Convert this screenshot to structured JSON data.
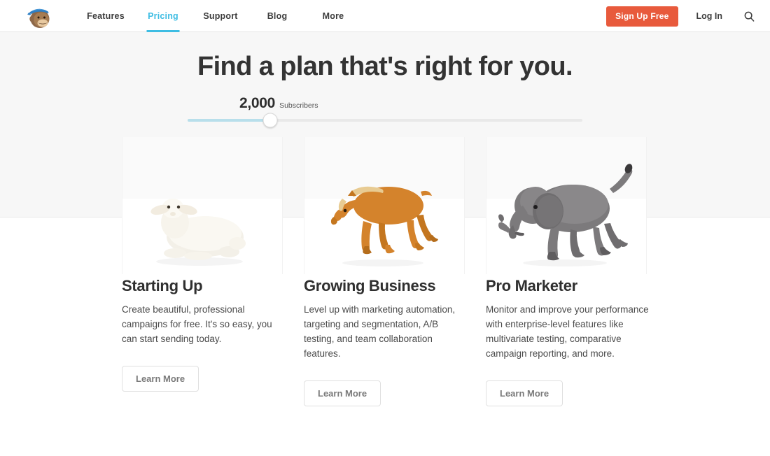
{
  "nav": {
    "logo_icon": "mailchimp-freddie-logo",
    "links": [
      {
        "label": "Features",
        "active": false
      },
      {
        "label": "Pricing",
        "active": true
      },
      {
        "label": "Support",
        "active": false
      },
      {
        "label": "Blog",
        "active": false
      },
      {
        "label": "More",
        "active": false
      }
    ],
    "signup_label": "Sign Up Free",
    "login_label": "Log In",
    "search_icon": "search-icon",
    "accent_color": "#3ebde3",
    "signup_color": "#e85a3c"
  },
  "hero": {
    "title": "Find a plan that's right for you.",
    "slider": {
      "count": "2,000",
      "unit": "Subscribers",
      "percent": 21,
      "fill_color": "#b8dfeb",
      "track_color": "#e9e9e9"
    },
    "background_color": "#f7f7f7"
  },
  "plans": [
    {
      "image_icon": "lamb-figurine-image",
      "title": "Starting Up",
      "description": "Create beautiful, professional campaigns for free. It's so easy, you can start sending today.",
      "button_label": "Learn More"
    },
    {
      "image_icon": "horse-figurine-image",
      "title": "Growing Business",
      "description": "Level up with marketing automation, targeting and segmentation, A/B testing, and team collaboration features.",
      "button_label": "Learn More"
    },
    {
      "image_icon": "elephant-figurine-image",
      "title": "Pro Marketer",
      "description": "Monitor and improve your performance with enterprise-level features like multivariate testing, comparative campaign reporting, and more.",
      "button_label": "Learn More"
    }
  ]
}
